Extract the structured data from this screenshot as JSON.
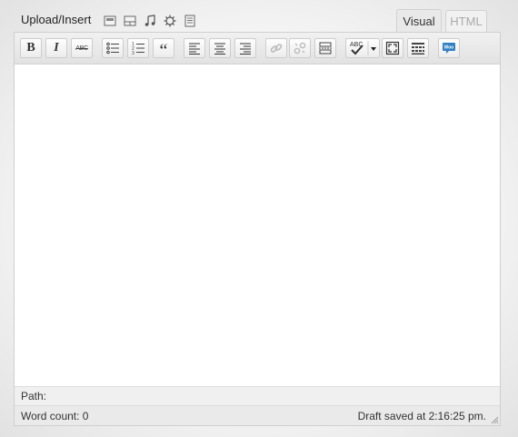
{
  "header": {
    "upload_label": "Upload/Insert",
    "media_icons": [
      "add-image-icon",
      "add-video-icon",
      "add-audio-icon",
      "add-media-icon",
      "add-document-icon"
    ]
  },
  "tabs": [
    {
      "label": "Visual",
      "active": true
    },
    {
      "label": "HTML",
      "active": false
    }
  ],
  "toolbar": {
    "bold": "B",
    "italic": "I",
    "strikethrough": "ABC",
    "blockquote": "“",
    "spellcheck": "ABC",
    "woo": "Woo"
  },
  "editor": {
    "content": ""
  },
  "path": {
    "label": "Path:"
  },
  "status": {
    "word_count": "Word count: 0",
    "draft_saved": "Draft saved at 2:16:25 pm."
  },
  "colors": {
    "accent_woo": "#2e7fc3",
    "toolbar_bg": "#e6e6e6"
  }
}
